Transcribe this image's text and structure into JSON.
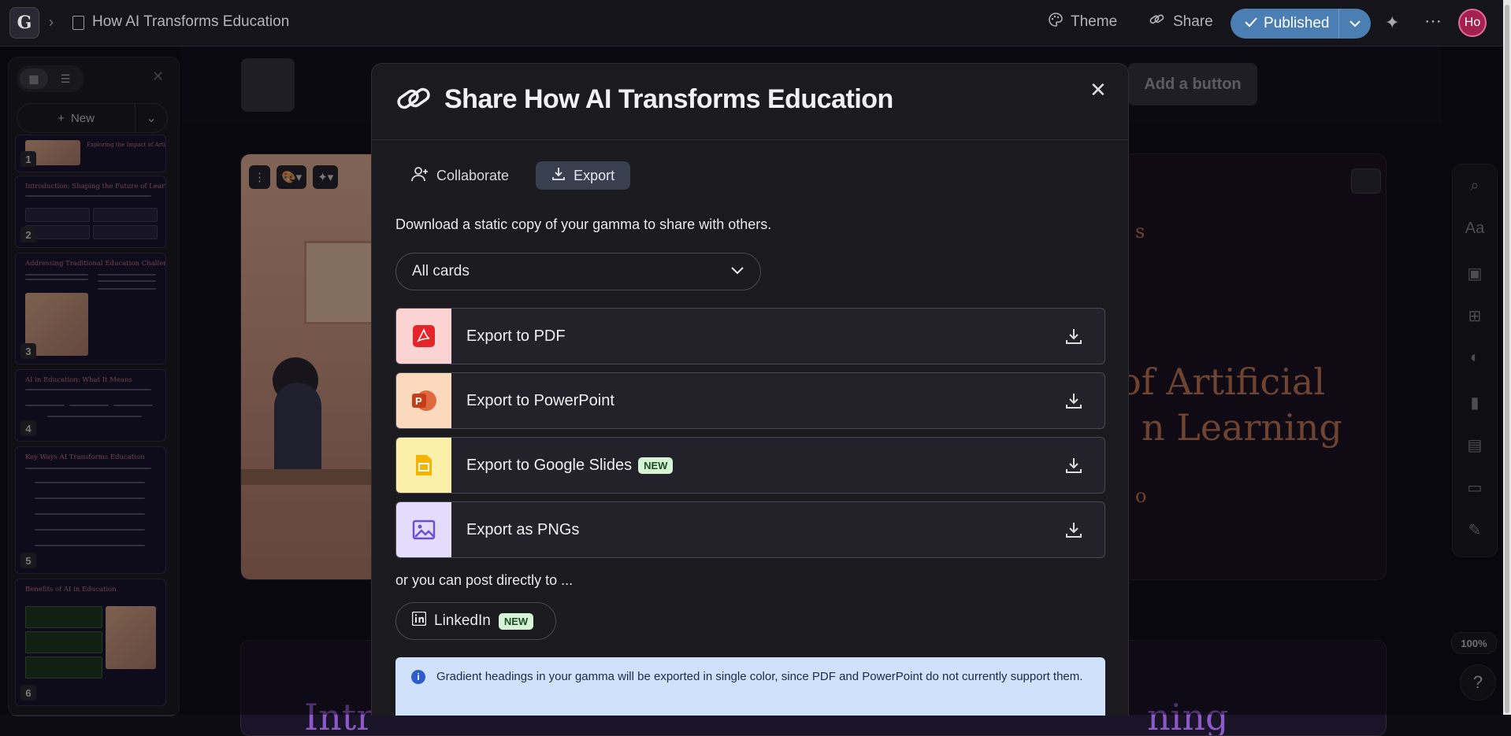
{
  "topbar": {
    "logo": "G",
    "doc_title": "How AI Transforms Education",
    "theme_label": "Theme",
    "share_label": "Share",
    "published_label": "Published",
    "avatar_initials": "Ho"
  },
  "editor": {
    "add_button_label": "Add a button",
    "card_title_line1": "of Artificial",
    "card_title_line2": "n Learning",
    "card_partial_top": "s",
    "card_partial_small": "o",
    "card2_partial_left": "Intr",
    "card2_partial_right": "ning",
    "zoom": "100%",
    "help": "?"
  },
  "sidebar": {
    "new_label": "New",
    "thumbnails": [
      {
        "num": "1",
        "title": "Exploring the Impact of Artificial Intelligence in Modern Learning"
      },
      {
        "num": "2",
        "title": "Introduction: Shaping the Future of Learning"
      },
      {
        "num": "3",
        "title": "Addressing Traditional Education Challenges"
      },
      {
        "num": "4",
        "title": "AI in Education: What It Means"
      },
      {
        "num": "5",
        "title": "Key Ways AI Transforms Education"
      },
      {
        "num": "6",
        "title": "Benefits of AI in Education"
      }
    ]
  },
  "modal": {
    "title": "Share How AI Transforms Education",
    "tabs": [
      {
        "label": "Collaborate",
        "active": false
      },
      {
        "label": "Export",
        "active": true
      }
    ],
    "description": "Download a static copy of your gamma to share with others.",
    "select_value": "All cards",
    "exports": [
      {
        "label": "Export to PDF",
        "icon": "pdf-icon",
        "bg": "#fbd3d3",
        "badge": ""
      },
      {
        "label": "Export to PowerPoint",
        "icon": "powerpoint-icon",
        "bg": "#fbd9bd",
        "badge": ""
      },
      {
        "label": "Export to Google Slides",
        "icon": "google-slides-icon",
        "bg": "#fbefa9",
        "badge": "NEW"
      },
      {
        "label": "Export as PNGs",
        "icon": "image-icon",
        "bg": "#e4dcfb",
        "badge": ""
      }
    ],
    "post_text": "or you can post directly to ...",
    "linkedin_label": "LinkedIn",
    "linkedin_badge": "NEW",
    "info_text": "Gradient headings in your gamma will be exported in single color, since PDF and PowerPoint do not currently support them."
  },
  "colors": {
    "accent_published": "#4b7fb3",
    "export_tab_bg": "#38404f",
    "info_bg": "#cfe1fb",
    "new_badge_bg": "#d7f4d6"
  }
}
